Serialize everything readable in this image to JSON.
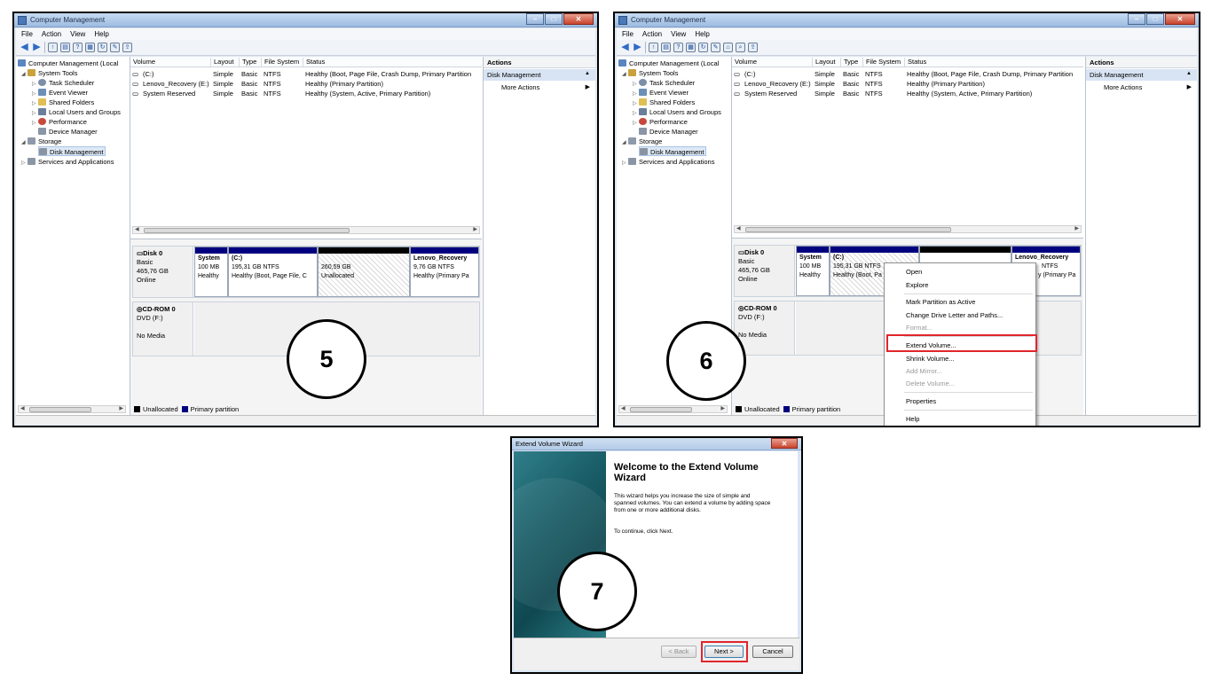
{
  "panels": {
    "p5": {
      "title": "Computer Management",
      "step": "5"
    },
    "p6": {
      "title": "Computer Management",
      "step": "6"
    },
    "p7": {
      "title": "Extend Volume Wizard",
      "step": "7"
    }
  },
  "menu": [
    "File",
    "Action",
    "View",
    "Help"
  ],
  "tree": {
    "root": "Computer Management (Local",
    "system_tools": "System Tools",
    "task_scheduler": "Task Scheduler",
    "event_viewer": "Event Viewer",
    "shared_folders": "Shared Folders",
    "local_users": "Local Users and Groups",
    "performance": "Performance",
    "device_manager": "Device Manager",
    "storage": "Storage",
    "disk_management": "Disk Management",
    "services": "Services and Applications"
  },
  "volume_table": {
    "headers": [
      "Volume",
      "Layout",
      "Type",
      "File System",
      "Status"
    ],
    "rows": [
      {
        "volume": "(C:)",
        "layout": "Simple",
        "type": "Basic",
        "fs": "NTFS",
        "status": "Healthy (Boot, Page File, Crash Dump, Primary Partition"
      },
      {
        "volume": "Lenovo_Recovery (E:)",
        "layout": "Simple",
        "type": "Basic",
        "fs": "NTFS",
        "status": "Healthy (Primary Partition)"
      },
      {
        "volume": "System Reserved",
        "layout": "Simple",
        "type": "Basic",
        "fs": "NTFS",
        "status": "Healthy (System, Active, Primary Partition)"
      }
    ]
  },
  "disk0": {
    "name": "Disk 0",
    "type": "Basic",
    "size": "465,76 GB",
    "state": "Online",
    "partitions": [
      {
        "name": "System",
        "size": "100 MB",
        "status": "Healthy"
      },
      {
        "name": "(C:)",
        "size": "195,31 GB NTFS",
        "status": "Healthy (Boot, Page File, C"
      },
      {
        "name": "",
        "size": "260,59 GB",
        "status": "Unallocated"
      },
      {
        "name": "Lenovo_Recovery",
        "size": "9,76 GB NTFS",
        "status": "Healthy (Primary Pa"
      }
    ]
  },
  "disk0_p6": {
    "c_status": "Healthy (Boot, Pa",
    "recovery_name": "Lenovo_Recovery",
    "recovery_size": "NTFS",
    "recovery_status": "y (Primary Pa"
  },
  "cdrom": {
    "name": "CD-ROM 0",
    "drive": "DVD (F:)",
    "media": "No Media"
  },
  "legend": {
    "unallocated": "Unallocated",
    "primary": "Primary partition",
    "unallocated_color": "#000000",
    "primary_color": "#00007f"
  },
  "actions": {
    "header": "Actions",
    "selected": "Disk Management",
    "more": "More Actions"
  },
  "context_menu": [
    {
      "label": "Open",
      "enabled": true
    },
    {
      "label": "Explore",
      "enabled": true
    },
    {
      "label": "Mark Partition as Active",
      "enabled": true
    },
    {
      "label": "Change Drive Letter and Paths...",
      "enabled": true
    },
    {
      "label": "Format...",
      "enabled": false
    },
    {
      "label": "Extend Volume...",
      "enabled": true
    },
    {
      "label": "Shrink Volume...",
      "enabled": true
    },
    {
      "label": "Add Mirror...",
      "enabled": false
    },
    {
      "label": "Delete Volume...",
      "enabled": false
    },
    {
      "label": "Properties",
      "enabled": true
    },
    {
      "label": "Help",
      "enabled": true
    }
  ],
  "wizard": {
    "heading": "Welcome to the Extend Volume Wizard",
    "body": "This wizard helps you increase the size of simple and spanned volumes. You can extend a volume by adding space from one or more additional disks.",
    "continue": "To continue, click Next.",
    "back": "< Back",
    "next": "Next >",
    "cancel": "Cancel"
  },
  "colors": {
    "highlight": "#e0262c",
    "partition_bar": "#00007f"
  }
}
